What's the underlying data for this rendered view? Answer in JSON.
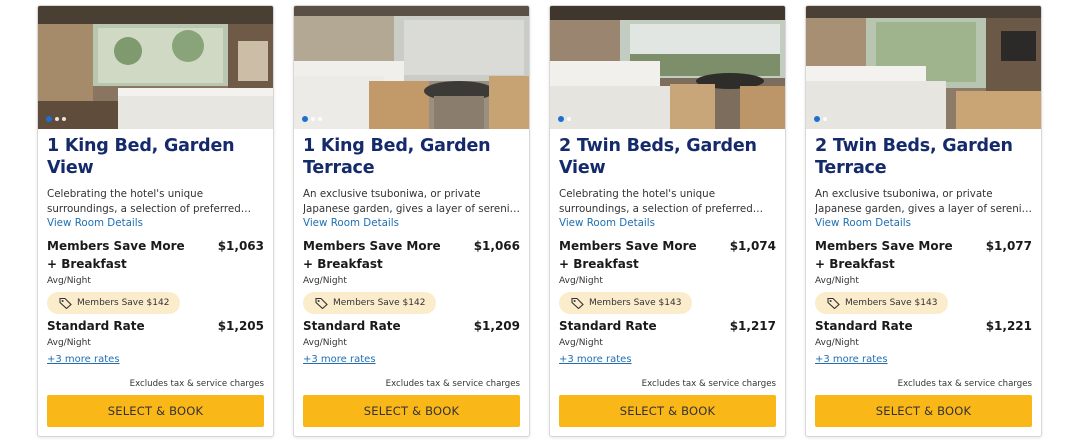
{
  "labels": {
    "view_details": "View Room Details",
    "avg_night": "Avg/Night",
    "excludes": "Excludes tax & service charges",
    "book": "SELECT & BOOK"
  },
  "rooms": [
    {
      "title": "1 King Bed, Garden View",
      "description": "Celebrating the hotel's unique surroundings, a selection of preferred views include both the…",
      "members_rate": {
        "name": "Members Save More + Breakfast",
        "price": "$1,063",
        "badge": "Members Save $142"
      },
      "standard_rate": {
        "name": "Standard Rate",
        "price": "$1,205"
      },
      "more_rates": "+3 more rates",
      "photo": {
        "slides": 3,
        "active_slide": 1
      }
    },
    {
      "title": "1 King Bed, Garden Terrace",
      "description": "An exclusive tsuboniwa, or private Japanese garden, gives a layer of serenity and calm. Th…",
      "members_rate": {
        "name": "Members Save More + Breakfast",
        "price": "$1,066",
        "badge": "Members Save $142"
      },
      "standard_rate": {
        "name": "Standard Rate",
        "price": "$1,209"
      },
      "more_rates": "+3 more rates",
      "photo": {
        "slides": 3,
        "active_slide": 1
      }
    },
    {
      "title": "2 Twin Beds, Garden View",
      "description": "Celebrating the hotel's unique surroundings, a selection of preferred views include both the…",
      "members_rate": {
        "name": "Members Save More + Breakfast",
        "price": "$1,074",
        "badge": "Members Save $143"
      },
      "standard_rate": {
        "name": "Standard Rate",
        "price": "$1,217"
      },
      "more_rates": "+3 more rates",
      "photo": {
        "slides": 2,
        "active_slide": 1
      }
    },
    {
      "title": "2 Twin Beds, Garden Terrace",
      "description": "An exclusive tsuboniwa, or private Japanese garden, gives a layer of serenity and calm. Th…",
      "members_rate": {
        "name": "Members Save More + Breakfast",
        "price": "$1,077",
        "badge": "Members Save $143"
      },
      "standard_rate": {
        "name": "Standard Rate",
        "price": "$1,221"
      },
      "more_rates": "+3 more rates",
      "photo": {
        "slides": 2,
        "active_slide": 1
      }
    }
  ],
  "colors": {
    "title": "#152a6b",
    "link": "#1f6fb2",
    "button": "#f9b718",
    "badge": "#fbeccc",
    "active_dot": "#1f6fd1"
  },
  "icons": {
    "badge": "tag-icon",
    "carousel": "carousel-dot-icon"
  }
}
